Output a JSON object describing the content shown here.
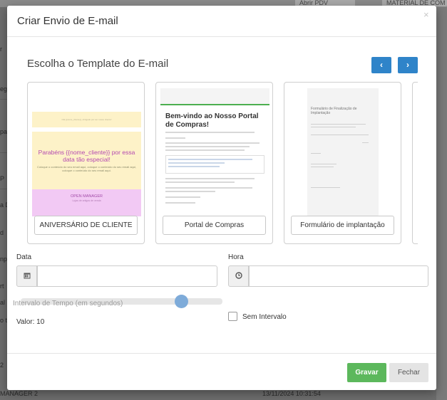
{
  "background": {
    "tabs": [
      "Abrir PDV",
      "MATERIAL DE COM"
    ],
    "left_fragments": [
      "r",
      "egi",
      "pag",
      "P",
      "a D",
      "d",
      "np",
      "rt",
      "al",
      "o ta",
      "2"
    ],
    "bottom_left": "MANAGER 2",
    "bottom_right": "13/11/2024 10:31:54"
  },
  "modal": {
    "title": "Criar Envio de E-mail",
    "close_glyph": "×",
    "section_title": "Escolha o Template do E-mail",
    "nav_prev": "‹",
    "nav_next": "›"
  },
  "templates": [
    {
      "label": "ANIVERSÁRIO DE CLIENTE",
      "preview": {
        "header": "Olá {{nome_cliente}}, obrigado por ser nosso cliente!",
        "headline": "Parabéns {{nome_cliente}} por essa data tão especial!",
        "body": "Coloque o conteúdo do seu email aqui, coloque o conteúdo do seu email aqui, coloque o conteúdo do seu email aqui.",
        "footer_title": "OPEN MANAGER",
        "footer_sub": "Lojas de artigos de venda"
      }
    },
    {
      "label": "Portal de Compras",
      "preview": {
        "headline": "Bem-vindo ao Nosso Portal de Compras!"
      }
    },
    {
      "label": "Formulário de implantação",
      "preview": {
        "headline": "Formulário de Finalização de Implantação"
      }
    }
  ],
  "form": {
    "data_label": "Data",
    "data_icon": "calendar-icon",
    "data_value": "",
    "hora_label": "Hora",
    "hora_icon": "clock-icon",
    "hora_value": "",
    "slider_label": "Intervalo de Tempo (em segundos)",
    "slider_fraction": 0.82,
    "value_text": "Valor: 10",
    "checkbox_label": "Sem Intervalo",
    "checkbox_checked": false
  },
  "footer": {
    "save_label": "Gravar",
    "close_label": "Fechar"
  },
  "colors": {
    "primary": "#2f84c9",
    "success": "#5cb85c",
    "template_yellow": "#fdf2c8",
    "template_pink": "#f2c9f4",
    "template_magenta": "#b44ab0",
    "portal_green": "#4caf50"
  }
}
